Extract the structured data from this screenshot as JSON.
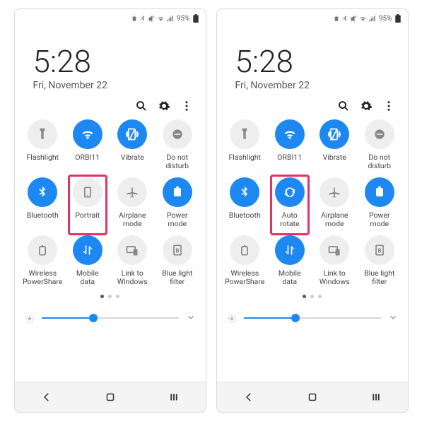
{
  "status": {
    "battery_pct": "95%"
  },
  "clock": {
    "time": "5:28",
    "date": "Fri, November 22"
  },
  "brightness": {
    "value_pct": 38
  },
  "panels": [
    {
      "tiles": [
        {
          "id": "flashlight",
          "label": "Flashlight",
          "on": false,
          "highlight": false,
          "icon": "flashlight"
        },
        {
          "id": "wifi",
          "label": "ORBI11",
          "on": true,
          "highlight": false,
          "icon": "wifi"
        },
        {
          "id": "vibrate",
          "label": "Vibrate",
          "on": true,
          "highlight": false,
          "icon": "vibrate"
        },
        {
          "id": "dnd",
          "label": "Do not\ndisturb",
          "on": false,
          "highlight": false,
          "icon": "dnd"
        },
        {
          "id": "bluetooth",
          "label": "Bluetooth",
          "on": true,
          "highlight": false,
          "icon": "bluetooth"
        },
        {
          "id": "rotation",
          "label": "Portrait",
          "on": false,
          "highlight": true,
          "icon": "portrait"
        },
        {
          "id": "airplane",
          "label": "Airplane\nmode",
          "on": false,
          "highlight": false,
          "icon": "airplane"
        },
        {
          "id": "power",
          "label": "Power\nmode",
          "on": true,
          "highlight": false,
          "icon": "power"
        },
        {
          "id": "powershare",
          "label": "Wireless\nPowerShare",
          "on": false,
          "highlight": false,
          "icon": "powershare"
        },
        {
          "id": "mobiledata",
          "label": "Mobile\ndata",
          "on": true,
          "highlight": false,
          "icon": "mobiledata"
        },
        {
          "id": "linkwin",
          "label": "Link to\nWindows",
          "on": false,
          "highlight": false,
          "icon": "linkwin"
        },
        {
          "id": "bluelight",
          "label": "Blue light\nfilter",
          "on": false,
          "highlight": false,
          "icon": "bluelight"
        }
      ]
    },
    {
      "tiles": [
        {
          "id": "flashlight",
          "label": "Flashlight",
          "on": false,
          "highlight": false,
          "icon": "flashlight"
        },
        {
          "id": "wifi",
          "label": "ORBI11",
          "on": true,
          "highlight": false,
          "icon": "wifi"
        },
        {
          "id": "vibrate",
          "label": "Vibrate",
          "on": true,
          "highlight": false,
          "icon": "vibrate"
        },
        {
          "id": "dnd",
          "label": "Do not\ndisturb",
          "on": false,
          "highlight": false,
          "icon": "dnd"
        },
        {
          "id": "bluetooth",
          "label": "Bluetooth",
          "on": true,
          "highlight": false,
          "icon": "bluetooth"
        },
        {
          "id": "rotation",
          "label": "Auto\nrotate",
          "on": true,
          "highlight": true,
          "icon": "autorotate"
        },
        {
          "id": "airplane",
          "label": "Airplane\nmode",
          "on": false,
          "highlight": false,
          "icon": "airplane"
        },
        {
          "id": "power",
          "label": "Power\nmode",
          "on": true,
          "highlight": false,
          "icon": "power"
        },
        {
          "id": "powershare",
          "label": "Wireless\nPowerShare",
          "on": false,
          "highlight": false,
          "icon": "powershare"
        },
        {
          "id": "mobiledata",
          "label": "Mobile\ndata",
          "on": true,
          "highlight": false,
          "icon": "mobiledata"
        },
        {
          "id": "linkwin",
          "label": "Link to\nWindows",
          "on": false,
          "highlight": false,
          "icon": "linkwin"
        },
        {
          "id": "bluelight",
          "label": "Blue light\nfilter",
          "on": false,
          "highlight": false,
          "icon": "bluelight"
        }
      ]
    }
  ]
}
